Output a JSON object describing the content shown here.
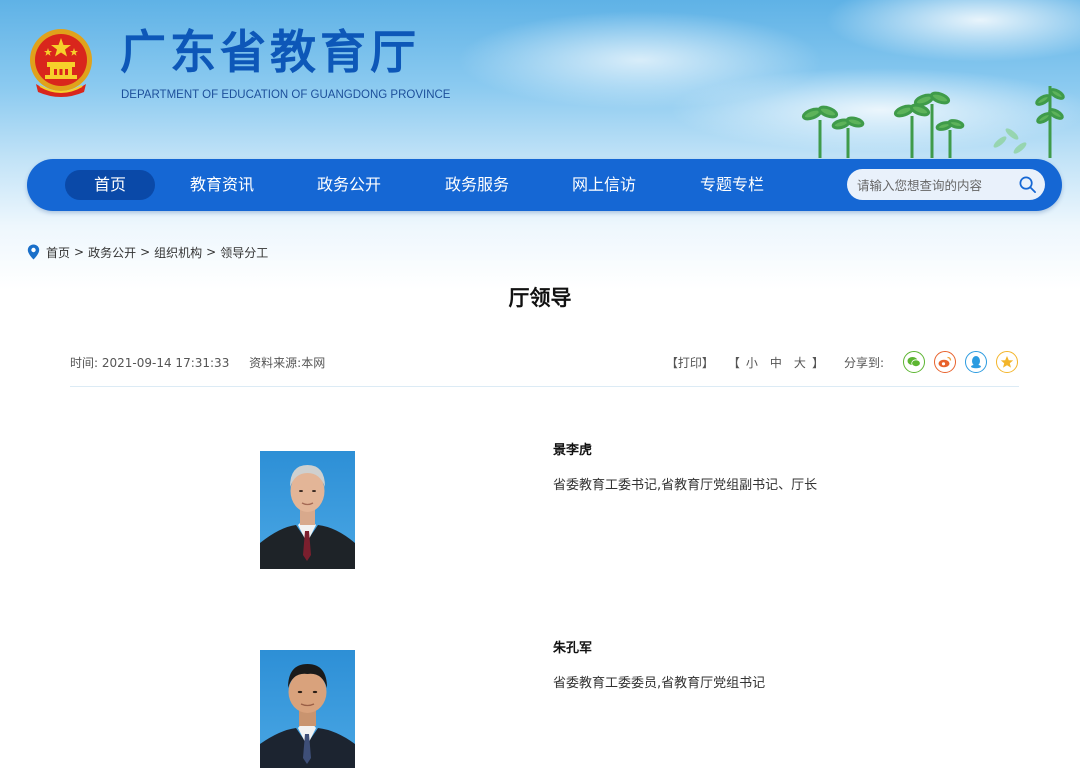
{
  "header": {
    "title": "广东省教育厅",
    "subtitle": "DEPARTMENT OF EDUCATION OF GUANGDONG PROVINCE"
  },
  "nav": {
    "items": [
      "首页",
      "教育资讯",
      "政务公开",
      "政务服务",
      "网上信访",
      "专题专栏"
    ],
    "active_index": 0,
    "search_placeholder": "请输入您想查询的内容"
  },
  "breadcrumb": [
    "首页",
    "政务公开",
    "组织机构",
    "领导分工"
  ],
  "breadcrumb_separator": ">",
  "article": {
    "title": "厅领导",
    "time_label": "时间:",
    "time_value": "2021-09-14 17:31:33",
    "source_label": "资料来源:",
    "source_value": "本网",
    "print_label": "【打印】",
    "size_open": "【",
    "size_small": "小",
    "size_medium": "中",
    "size_large": "大",
    "size_close": "】",
    "share_label": "分享到:",
    "share_icons": [
      "wechat-icon",
      "weibo-icon",
      "qq-icon",
      "qzone-icon"
    ]
  },
  "leaders": [
    {
      "name": "景李虎",
      "title": "省委教育工委书记,省教育厅党组副书记、厅长"
    },
    {
      "name": "朱孔军",
      "title": "省委教育工委委员,省教育厅党组书记"
    }
  ],
  "colors": {
    "nav_bg": "#1567d4",
    "nav_active": "#0a49a8",
    "title_blue": "#0d57b8",
    "wechat": "#5cb531",
    "weibo": "#e8622c",
    "qq": "#2b9be0",
    "qzone": "#f3b52b"
  }
}
